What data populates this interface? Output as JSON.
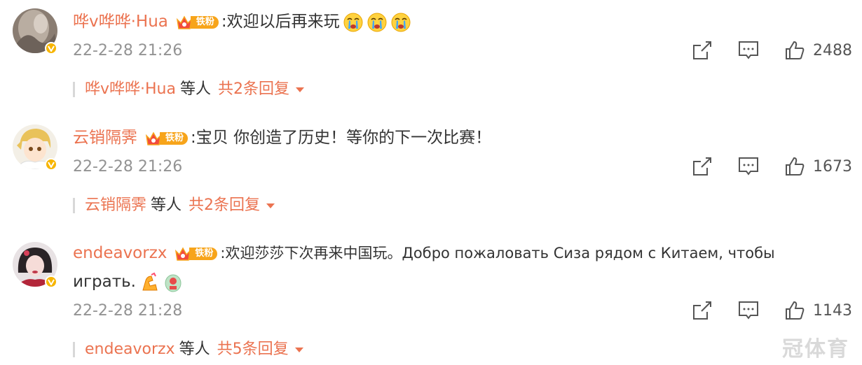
{
  "comments": [
    {
      "username": "哗v哗哗·Hua",
      "fan_badge": "铁粉",
      "text": ":欢迎以后再来玩",
      "text_line2": "",
      "emoji_count": 3,
      "time": "22-2-28 21:26",
      "likes": "2488",
      "reply_user": "哗v哗哗·Hua",
      "reply_mid": "等人",
      "reply_count": "共2条回复"
    },
    {
      "username": "云销隔霁",
      "fan_badge": "铁粉",
      "text": ":宝贝 你创造了历史！等你的下一次比赛！",
      "text_line2": "",
      "emoji_count": 0,
      "time": "22-2-28 21:26",
      "likes": "1673",
      "reply_user": "云销隔霁",
      "reply_mid": "等人",
      "reply_count": "共2条回复"
    },
    {
      "username": "endeavorzx",
      "fan_badge": "铁粉",
      "text": ":欢迎莎莎下次再来中国玩。Добро пожаловать Сиза рядом с Китаем, чтобы",
      "text_line2": "играть.",
      "emoji_count": 2,
      "time": "22-2-28 21:28",
      "likes": "1143",
      "reply_user": "endeavorzx",
      "reply_mid": "等人",
      "reply_count": "共5条回复"
    }
  ],
  "watermark": "冠体育",
  "icons": {
    "share": "share-icon",
    "comment": "comment-icon",
    "like": "thumbs-up-icon",
    "verified": "verified-badge-icon",
    "expand": "caret-down-icon"
  },
  "colors": {
    "username": "#eb7350",
    "timestamp": "#939393",
    "badge": "#f7a41a",
    "verified": "#f7b500"
  }
}
